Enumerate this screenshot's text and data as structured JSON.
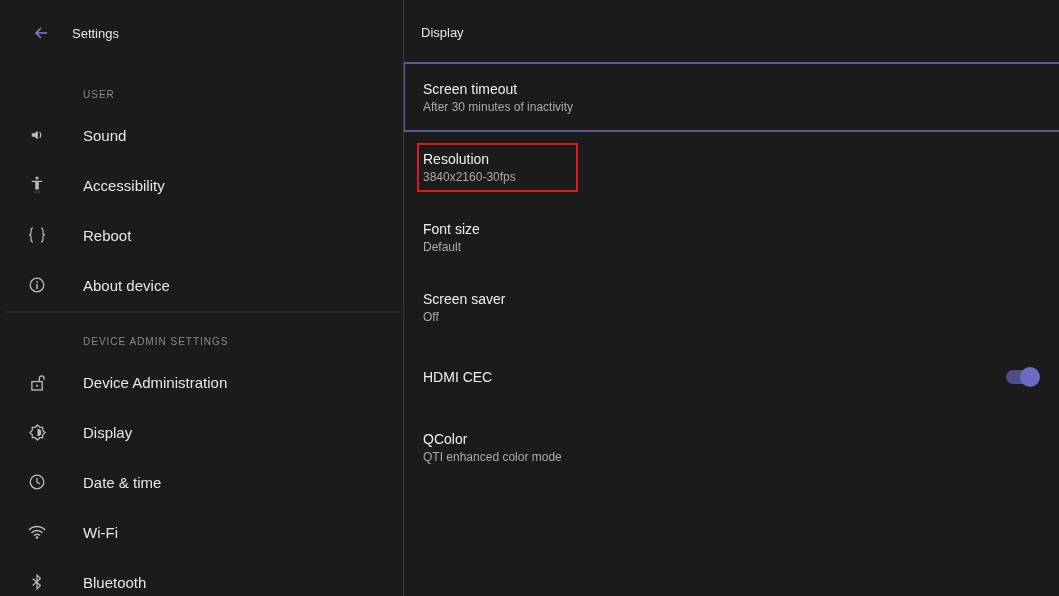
{
  "sidebar": {
    "title": "Settings",
    "sections": [
      {
        "header": "USER",
        "items": [
          {
            "kind": "speaker",
            "label": "Sound"
          },
          {
            "kind": "person",
            "label": "Accessibility"
          },
          {
            "kind": "braces",
            "label": "Reboot"
          },
          {
            "kind": "info",
            "label": "About device"
          }
        ]
      },
      {
        "header": "DEVICE ADMIN SETTINGS",
        "items": [
          {
            "kind": "lock",
            "label": "Device Administration"
          },
          {
            "kind": "brightness",
            "label": "Display"
          },
          {
            "kind": "clock",
            "label": "Date & time"
          },
          {
            "kind": "wifi",
            "label": "Wi-Fi"
          },
          {
            "kind": "bluetooth",
            "label": "Bluetooth"
          }
        ]
      }
    ]
  },
  "panel": {
    "title": "Display",
    "items": [
      {
        "kind": "text",
        "title": "Screen timeout",
        "summary": "After 30 minutes of inactivity",
        "focused": true,
        "highlighted": false
      },
      {
        "kind": "text",
        "title": "Resolution",
        "summary": "3840x2160-30fps",
        "focused": false,
        "highlighted": true
      },
      {
        "kind": "text",
        "title": "Font size",
        "summary": "Default",
        "focused": false,
        "highlighted": false
      },
      {
        "kind": "text",
        "title": "Screen saver",
        "summary": "Off",
        "focused": false,
        "highlighted": false
      },
      {
        "kind": "toggle",
        "title": "HDMI CEC",
        "on": true,
        "focused": false,
        "highlighted": false
      },
      {
        "kind": "text",
        "title": "QColor",
        "summary": "QTI enhanced color mode",
        "focused": false,
        "highlighted": false
      }
    ]
  }
}
